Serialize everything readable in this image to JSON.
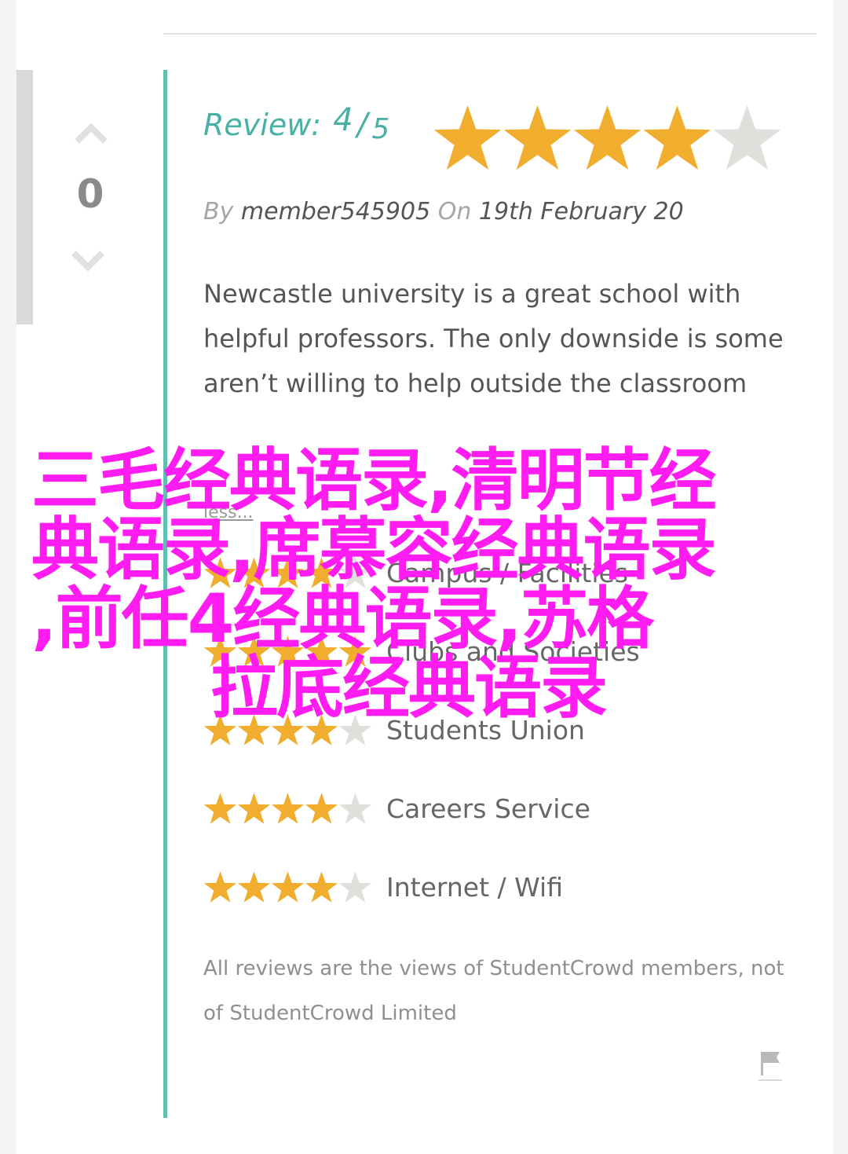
{
  "vote": {
    "count": "0"
  },
  "review": {
    "label": "Review:",
    "score": "4",
    "slash": "/",
    "max": "5",
    "stars_filled": 4,
    "stars_total": 5
  },
  "byline": {
    "by": "By",
    "author": "member545905",
    "on": "On",
    "date": "19th February 20"
  },
  "body": "Newcastle university is a great school with helpful professors. The only downside is some aren’t willing to help outside the classroom",
  "less_link": "less...",
  "ratings": [
    {
      "label": "Campus / Facilities",
      "stars": 4
    },
    {
      "label": "Clubs and Societies",
      "stars": 5
    },
    {
      "label": "Students Union",
      "stars": 4
    },
    {
      "label": "Careers Service",
      "stars": 4
    },
    {
      "label": "Internet / Wifi",
      "stars": 4
    }
  ],
  "disclaimer": "All reviews are the views of StudentCrowd members, not of StudentCrowd Limited",
  "overlay": {
    "line1": "三毛经典语录,清明节经",
    "line2": "典语录,席慕容经典语录",
    "line3": ",前任4经典语录,苏格",
    "line4": "拉底经典语录"
  },
  "colors": {
    "accent_teal": "#5cbfb0",
    "star_filled": "#f0ad2e",
    "star_empty": "#e0dfdb",
    "overlay_text": "#ff1cf0"
  },
  "icons": [
    "upvote-chevron-icon",
    "downvote-chevron-icon",
    "star-icon",
    "flag-icon"
  ]
}
